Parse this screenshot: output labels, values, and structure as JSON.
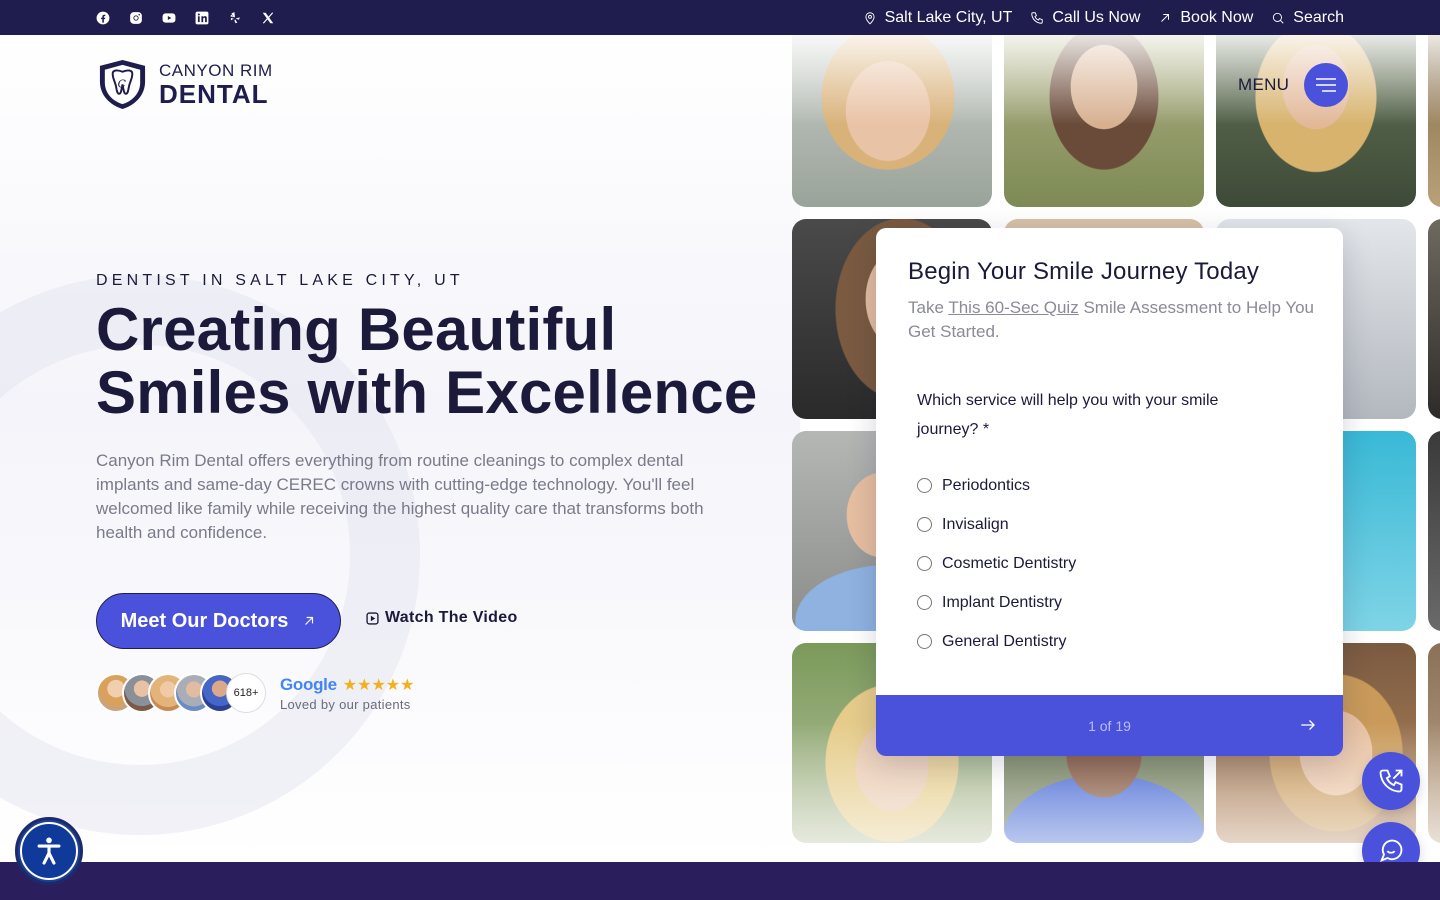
{
  "topbar": {
    "social_icons": [
      "facebook-icon",
      "instagram-icon",
      "youtube-icon",
      "linkedin-icon",
      "yelp-icon",
      "x-icon"
    ],
    "location": "Salt Lake City, UT",
    "call": "Call Us Now",
    "book": "Book Now",
    "search": "Search"
  },
  "logo": {
    "line1": "CANYON RIM",
    "line2": "DENTAL"
  },
  "menu": {
    "label": "MENU"
  },
  "hero": {
    "eyebrow": "DENTIST IN SALT LAKE CITY, UT",
    "title_line1": "Creating Beautiful",
    "title_line2": "Smiles with Excellence",
    "lead": "Canyon Rim Dental offers everything from routine cleanings to complex dental implants and same-day CEREC crowns with cutting-edge technology. You'll feel welcomed like family while receiving the highest quality care that transforms both health and confidence.",
    "cta_label": "Meet Our Doctors",
    "video_label": "Watch The Video"
  },
  "reviews": {
    "count": "618+",
    "brand": "Google",
    "stars": "★★★★★",
    "caption": "Loved by our patients"
  },
  "quiz": {
    "title": "Begin Your Smile Journey Today",
    "sub_prefix": "Take ",
    "sub_link": "This 60-Sec Quiz",
    "sub_suffix": " Smile Assessment  to Help You Get Started.",
    "question": "Which service will help you with your smile journey? *",
    "options": [
      "Periodontics",
      "Invisalign",
      "Cosmetic Dentistry",
      "Implant Dentistry",
      "General Dentistry"
    ],
    "progress": "1 of 19"
  },
  "colors": {
    "primary": "#4a52dc",
    "navy": "#1f1d4e",
    "text": "#1b1a3a",
    "muted": "#7a7a8a"
  }
}
